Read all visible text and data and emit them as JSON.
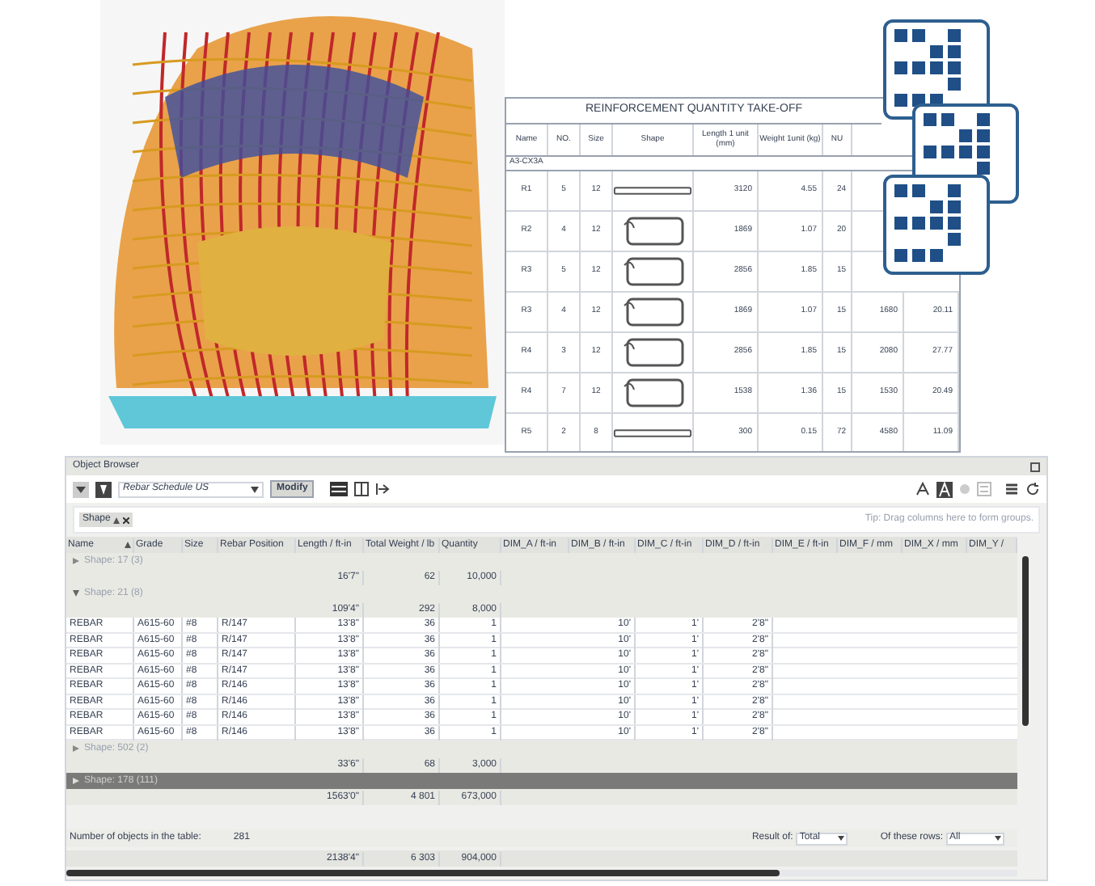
{
  "takeoff": {
    "title": "REINFORCEMENT QUANTITY TAKE-OFF",
    "columns": [
      "Name",
      "NO.",
      "Size",
      "Shape",
      "Length 1 unit (mm)",
      "Weight 1unit (kg)",
      "NU"
    ],
    "group": "A3-CX3A",
    "rows": [
      {
        "kind": "straight",
        "name": "R1",
        "no": "5",
        "size": "12",
        "length": "3120",
        "unit_weight": "4.55",
        "nu": "24"
      },
      {
        "kind": "stirrup",
        "name": "R2",
        "no": "4",
        "size": "12",
        "length": "1869",
        "unit_weight": "1.07",
        "nu": "20"
      },
      {
        "kind": "stirrup",
        "name": "R3",
        "no": "5",
        "size": "12",
        "length": "2856",
        "unit_weight": "1.85",
        "nu": "15"
      },
      {
        "kind": "stirrup",
        "name": "R3",
        "no": "4",
        "size": "12",
        "length": "1869",
        "unit_weight": "1.07",
        "nu": "15",
        "total_length": "1680",
        "total_weight": "20.11"
      },
      {
        "kind": "stirrup",
        "name": "R4",
        "no": "3",
        "size": "12",
        "length": "2856",
        "unit_weight": "1.85",
        "nu": "15",
        "total_length": "2080",
        "total_weight": "27.77"
      },
      {
        "kind": "stirrup",
        "name": "R4",
        "no": "7",
        "size": "12",
        "length": "1538",
        "unit_weight": "1.36",
        "nu": "15",
        "total_length": "1530",
        "total_weight": "20.49"
      },
      {
        "kind": "straight",
        "name": "R5",
        "no": "2",
        "size": "8",
        "length": "300",
        "unit_weight": "0.15",
        "nu": "72",
        "total_length": "4580",
        "total_weight": "11.09"
      }
    ]
  },
  "browser": {
    "title": "Object Browser",
    "schedule": "Rebar Schedule US",
    "modify": "Modify",
    "group_chip": "Shape",
    "group_hint": "Tip: Drag columns here to form groups.",
    "columns": [
      {
        "label": "Name",
        "sorted": true
      },
      {
        "label": "Grade",
        "sorted": false
      },
      {
        "label": "Size",
        "sorted": false
      },
      {
        "label": "Rebar Position",
        "sorted": false
      },
      {
        "label": "Length / ft-in",
        "sorted": false
      },
      {
        "label": "Total Weight / lb",
        "sorted": false
      },
      {
        "label": "Quantity",
        "sorted": false
      },
      {
        "label": "DIM_A / ft-in",
        "sorted": false
      },
      {
        "label": "DIM_B / ft-in",
        "sorted": false
      },
      {
        "label": "DIM_C / ft-in",
        "sorted": false
      },
      {
        "label": "DIM_D / ft-in",
        "sorted": false
      },
      {
        "label": "DIM_E / ft-in",
        "sorted": false
      },
      {
        "label": "DIM_F / mm",
        "sorted": false
      },
      {
        "label": "DIM_X / mm",
        "sorted": false
      },
      {
        "label": "DIM_Y /",
        "sorted": false
      }
    ],
    "groups": [
      {
        "label": "Shape: 17 (3)",
        "expanded": false,
        "selected": false,
        "subtotals": [
          "16'7\"",
          "62",
          "10,000"
        ]
      },
      {
        "label": "Shape: 21 (8)",
        "expanded": true,
        "selected": false,
        "subtotals": [
          "109'4\"",
          "292",
          "8,000"
        ],
        "rows": [
          {
            "name": "REBAR",
            "grade": "A615-60",
            "size": "#8",
            "position": "R/147",
            "length": "13'8\"",
            "weight": "36",
            "quantity": "1",
            "dim_b": "10'",
            "dim_c": "1'",
            "dim_d": "2'8\""
          },
          {
            "name": "REBAR",
            "grade": "A615-60",
            "size": "#8",
            "position": "R/147",
            "length": "13'8\"",
            "weight": "36",
            "quantity": "1",
            "dim_b": "10'",
            "dim_c": "1'",
            "dim_d": "2'8\""
          },
          {
            "name": "REBAR",
            "grade": "A615-60",
            "size": "#8",
            "position": "R/147",
            "length": "13'8\"",
            "weight": "36",
            "quantity": "1",
            "dim_b": "10'",
            "dim_c": "1'",
            "dim_d": "2'8\""
          },
          {
            "name": "REBAR",
            "grade": "A615-60",
            "size": "#8",
            "position": "R/147",
            "length": "13'8\"",
            "weight": "36",
            "quantity": "1",
            "dim_b": "10'",
            "dim_c": "1'",
            "dim_d": "2'8\""
          },
          {
            "name": "REBAR",
            "grade": "A615-60",
            "size": "#8",
            "position": "R/146",
            "length": "13'8\"",
            "weight": "36",
            "quantity": "1",
            "dim_b": "10'",
            "dim_c": "1'",
            "dim_d": "2'8\""
          },
          {
            "name": "REBAR",
            "grade": "A615-60",
            "size": "#8",
            "position": "R/146",
            "length": "13'8\"",
            "weight": "36",
            "quantity": "1",
            "dim_b": "10'",
            "dim_c": "1'",
            "dim_d": "2'8\""
          },
          {
            "name": "REBAR",
            "grade": "A615-60",
            "size": "#8",
            "position": "R/146",
            "length": "13'8\"",
            "weight": "36",
            "quantity": "1",
            "dim_b": "10'",
            "dim_c": "1'",
            "dim_d": "2'8\""
          },
          {
            "name": "REBAR",
            "grade": "A615-60",
            "size": "#8",
            "position": "R/146",
            "length": "13'8\"",
            "weight": "36",
            "quantity": "1",
            "dim_b": "10'",
            "dim_c": "1'",
            "dim_d": "2'8\""
          }
        ]
      },
      {
        "label": "Shape: 502 (2)",
        "expanded": false,
        "selected": false,
        "subtotals": [
          "33'6\"",
          "68",
          "3,000"
        ]
      },
      {
        "label": "Shape: 178 (111)",
        "expanded": false,
        "selected": true,
        "subtotals": [
          "1563'0\"",
          "4 801",
          "673,000"
        ]
      }
    ],
    "count_label": "Number of objects in the table:",
    "count": "281",
    "result_label": "Result of:",
    "result": "Total",
    "rows_label": "Of these rows:",
    "rows_value": "All",
    "totals": [
      "2138'4\"",
      "6 303",
      "904,000"
    ]
  }
}
